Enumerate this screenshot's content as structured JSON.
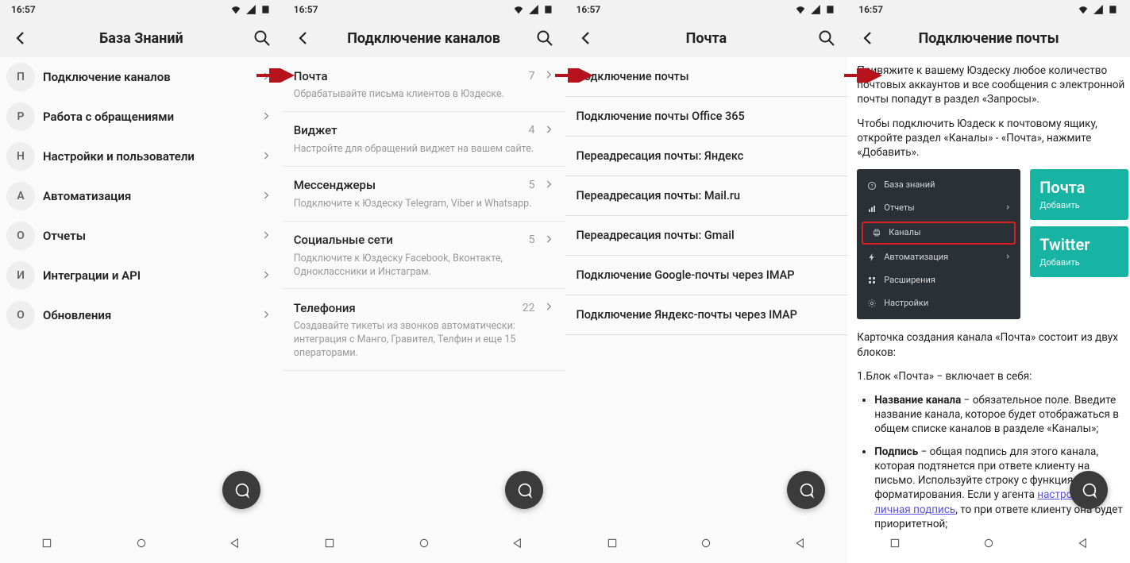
{
  "time": "16:57",
  "screens": [
    {
      "title": "База Знаний",
      "items": [
        {
          "letter": "П",
          "label": "Подключение каналов"
        },
        {
          "letter": "Р",
          "label": "Работа с обращениями"
        },
        {
          "letter": "Н",
          "label": "Настройки и пользователи"
        },
        {
          "letter": "А",
          "label": "Автоматизация"
        },
        {
          "letter": "О",
          "label": "Отчеты"
        },
        {
          "letter": "И",
          "label": "Интеграции и API"
        },
        {
          "letter": "О",
          "label": "Обновления"
        }
      ]
    },
    {
      "title": "Подключение каналов",
      "items": [
        {
          "title": "Почта",
          "count": "7",
          "desc": "Обрабатывайте письма клиентов в Юздеске."
        },
        {
          "title": "Виджет",
          "count": "4",
          "desc": "Настройте для обращений виджет на вашем сайте."
        },
        {
          "title": "Мессенджеры",
          "count": "5",
          "desc": "Подключите к Юздеску Telegram, Viber и Whatsapp."
        },
        {
          "title": "Социальные сети",
          "count": "5",
          "desc": "Подключите к Юздеску Facebook, Вконтакте, Одноклассники и Инстаграм."
        },
        {
          "title": "Телефония",
          "count": "22",
          "desc": "Создавайте тикеты из звонков автоматически: интеграция с Манго, Гравител, Телфин и еще 15 операторами."
        }
      ]
    },
    {
      "title": "Почта",
      "items": [
        "Подключение почты",
        "Подключение почты Office 365",
        "Переадресация почты: Яндекс",
        "Переадресация почты: Mail.ru",
        "Переадресация почты: Gmail",
        "Подключение Google-почты через IMAP",
        "Подключение Яндекс-почты через IMAP"
      ]
    },
    {
      "title": "Подключение почты",
      "p1": "Привяжите к вашему Юздеску любое количество почтовых аккаунтов и все сообщения с электронной почты попадут в раздел «Запросы».",
      "p2": "Чтобы подключить Юздеск к почтовому ящику, откройте раздел «Каналы» - «Почта», нажмите «Добавить».",
      "menu": [
        {
          "label": "База знаний",
          "icon": "question"
        },
        {
          "label": "Отчеты",
          "icon": "chart",
          "chev": true
        },
        {
          "label": "Каналы",
          "icon": "printer",
          "highlight": true
        },
        {
          "label": "Автоматизация",
          "icon": "bolt",
          "chev": true
        },
        {
          "label": "Расширения",
          "icon": "grid"
        },
        {
          "label": "Настройки",
          "icon": "gear"
        }
      ],
      "tile1_big": "Почта",
      "tile1_sm": "Добавить",
      "tile2_big": "Twitter",
      "tile2_sm": "Добавить",
      "p3": "Карточка создания канала «Почта» состоит из двух блоков:",
      "ol1": "1.Блок «Почта» − включает в себя:",
      "li1_b": "Название канала",
      "li1_t": " − обязательное поле. Введите название канала, которое будет отображаться в общем списке каналов в разделе «Каналы»;",
      "li2_b": "Подпись",
      "li2_t1": " − общая подпись для этого канала, которая подтянется при ответе клиенту на письмо. Используйте строку с функциями форматирования. Если у агента ",
      "li2_link": "настроена личная подпись",
      "li2_t2": ", то при ответе клиенту она будет приоритетной;"
    }
  ]
}
